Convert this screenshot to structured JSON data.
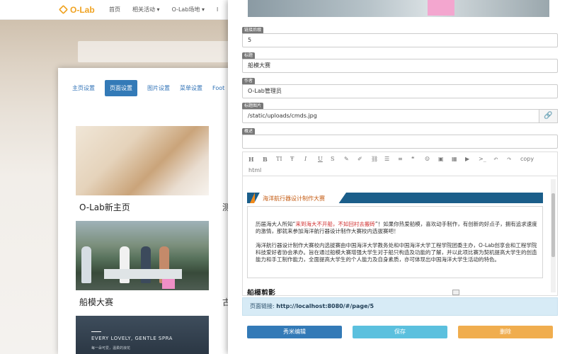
{
  "site": {
    "logo_text": "O-Lab",
    "nav": [
      "首页",
      "相关活动 ▾",
      "O-Lab场地 ▾",
      "l"
    ]
  },
  "settings": {
    "tabs": [
      "主页设置",
      "页面设置",
      "图片设置",
      "菜单设置",
      "Foot"
    ],
    "active_tab": "页面设置",
    "cards": [
      {
        "label": "O-Lab新主页"
      },
      {
        "label": "船模大赛"
      }
    ],
    "cut_labels": [
      "测",
      "古"
    ],
    "card3_text": "EVERY LOVELY, GENTLE SPRA",
    "card3_subtext": "每一朵可爱，温柔的浪花"
  },
  "editor": {
    "fields": [
      {
        "label": "链接后缀",
        "value": "5"
      },
      {
        "label": "标题",
        "value": "船模大赛"
      },
      {
        "label": "作者",
        "value": "O-Lab管理员"
      },
      {
        "label": "标题图片",
        "value": "/static/uploads/cmds.jpg"
      },
      {
        "label": "概述",
        "value": ""
      }
    ],
    "toolbar": {
      "icons": [
        "heading-icon",
        "bold-icon",
        "text-height-icon",
        "strikethrough-icon",
        "italic-icon",
        "underline-icon",
        "eraser-icon",
        "pencil-icon",
        "brush-icon",
        "link-icon",
        "list-ul-icon",
        "list-ol-icon",
        "quote-icon",
        "emoji-icon",
        "image-icon",
        "table-icon",
        "video-icon",
        "code-icon",
        "undo-icon",
        "redo-icon"
      ],
      "copy_label": "copy",
      "html_label": "html"
    },
    "content": {
      "banner_title": "海洋航行器设计制作大赛",
      "p1_a": "历届海大人所知“",
      "p1_red": "来到海大不开船，不如回村去搬砖",
      "p1_b": "”！如果你热爱船模，喜欢动手制作，有创新的好点子，拥有追求速度的激情，那就来参加海洋航行器设计制作大赛校内选拔赛吧！",
      "p2": "海洋航行器设计制作大赛校内选拔赛由中国海洋大学教务处和中国海洋大学工程学院团委主办，O-Lab创享会和工程学院科技爱好者协会承办。旨在通过船模大赛增强大学生对于船只构造及功能的了解，并以此项比赛为契机提高大学生的创造能力和手工制作能力，全面提高大学生的个人能力及自身素质，亦可体现出中国海洋大学生活动的特色。",
      "subheading": "船模剪影"
    },
    "page_link_label": "页面链接:",
    "page_link_url": "http://localhost:8080/#/page/5",
    "buttons": {
      "xiumi": "秀米编辑",
      "save": "保存",
      "delete": "删除"
    }
  }
}
